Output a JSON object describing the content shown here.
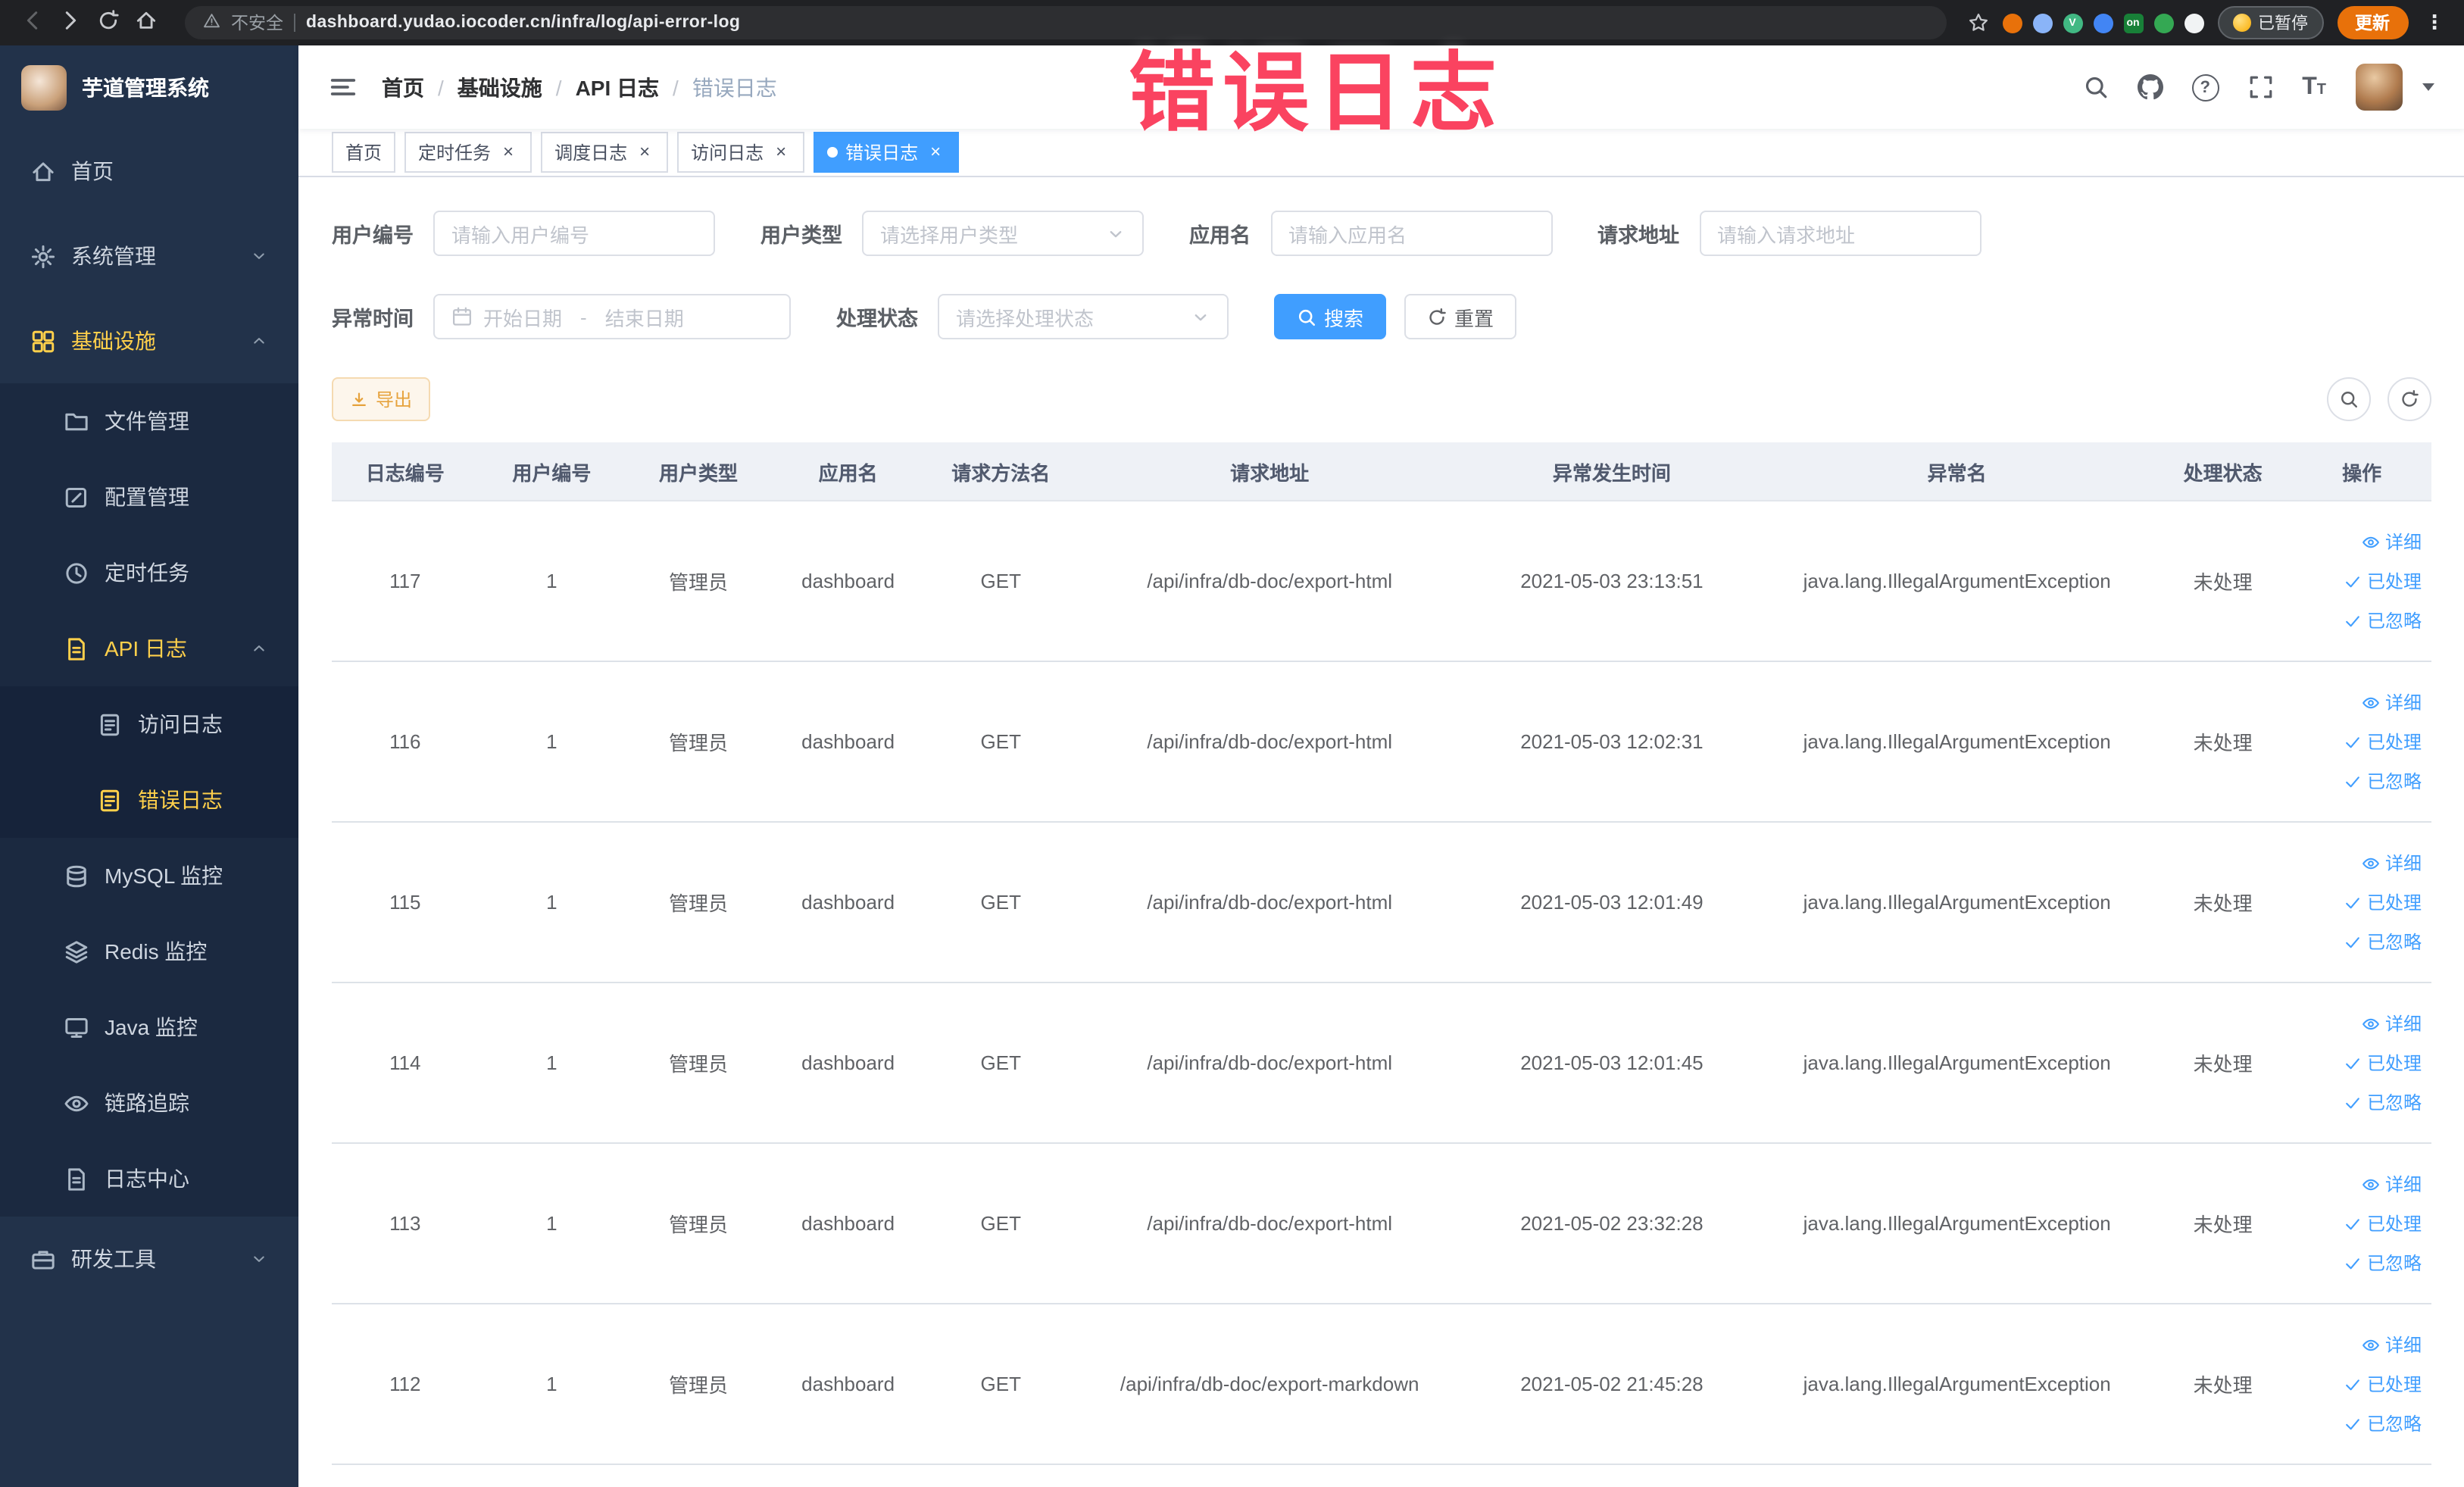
{
  "browser": {
    "security_label": "不安全",
    "url": "dashboard.yudao.iocoder.cn/infra/log/api-error-log",
    "paused_badge": "已暂停",
    "update_button": "更新",
    "extensions": [
      {
        "name": "extension-orange-icon",
        "color": "#e8710a",
        "glyph": ""
      },
      {
        "name": "extension-lightblue-icon",
        "color": "#8ab4f8",
        "glyph": ""
      },
      {
        "name": "extension-vue-devtools-icon",
        "color": "#41b883",
        "glyph": "V"
      },
      {
        "name": "extension-blue-grid-icon",
        "color": "#4285f4",
        "glyph": ""
      },
      {
        "name": "extension-on-badge-icon",
        "color": "#188038",
        "glyph": "on",
        "square": true
      },
      {
        "name": "extension-green-leaf-icon",
        "color": "#34a853",
        "glyph": ""
      },
      {
        "name": "extension-dark-paw-icon",
        "color": "#f1f3f4",
        "glyph": ""
      }
    ]
  },
  "annotation": {
    "text": "错误日志",
    "color": "#fa4360"
  },
  "sidebar": {
    "logo_title": "芋道管理系统",
    "items": [
      {
        "name": "home",
        "label": "首页",
        "icon": "home",
        "level": 1
      },
      {
        "name": "system-management",
        "label": "系统管理",
        "icon": "gear",
        "level": 1,
        "arrow": "down"
      },
      {
        "name": "infrastructure",
        "label": "基础设施",
        "icon": "grid",
        "level": 1,
        "arrow": "up",
        "gold": true
      },
      {
        "name": "file-management",
        "label": "文件管理",
        "icon": "folder",
        "level": 2
      },
      {
        "name": "config-management",
        "label": "配置管理",
        "icon": "edit",
        "level": 2
      },
      {
        "name": "scheduled-jobs",
        "label": "定时任务",
        "icon": "clock",
        "level": 2
      },
      {
        "name": "api-log",
        "label": "API 日志",
        "icon": "doc",
        "level": 2,
        "arrow": "up",
        "gold": true
      },
      {
        "name": "access-log",
        "label": "访问日志",
        "icon": "doc2",
        "level": 3
      },
      {
        "name": "error-log",
        "label": "错误日志",
        "icon": "doc2",
        "level": 3,
        "gold": true
      },
      {
        "name": "mysql-monitor",
        "label": "MySQL 监控",
        "icon": "db",
        "level": 2
      },
      {
        "name": "redis-monitor",
        "label": "Redis 监控",
        "icon": "layers",
        "level": 2
      },
      {
        "name": "java-monitor",
        "label": "Java 监控",
        "icon": "monitor",
        "level": 2
      },
      {
        "name": "trace",
        "label": "链路追踪",
        "icon": "eye",
        "level": 2
      },
      {
        "name": "log-center",
        "label": "日志中心",
        "icon": "doc",
        "level": 2
      },
      {
        "name": "dev-tools",
        "label": "研发工具",
        "icon": "toolbox",
        "level": 1,
        "arrow": "down"
      }
    ]
  },
  "breadcrumb": {
    "items": [
      "首页",
      "基础设施",
      "API 日志",
      "错误日志"
    ]
  },
  "tabs": {
    "items": [
      {
        "name": "home",
        "label": "首页",
        "closable": false,
        "active": false
      },
      {
        "name": "scheduled-jobs",
        "label": "定时任务",
        "closable": true,
        "active": false
      },
      {
        "name": "schedule-log",
        "label": "调度日志",
        "closable": true,
        "active": false
      },
      {
        "name": "access-log",
        "label": "访问日志",
        "closable": true,
        "active": false
      },
      {
        "name": "error-log",
        "label": "错误日志",
        "closable": true,
        "active": true
      }
    ]
  },
  "filters": {
    "user_id": {
      "label": "用户编号",
      "placeholder": "请输入用户编号"
    },
    "user_type": {
      "label": "用户类型",
      "placeholder": "请选择用户类型"
    },
    "app_name": {
      "label": "应用名",
      "placeholder": "请输入应用名"
    },
    "request_url": {
      "label": "请求地址",
      "placeholder": "请输入请求地址"
    },
    "exception_time": {
      "label": "异常时间",
      "start_placeholder": "开始日期",
      "separator": "-",
      "end_placeholder": "结束日期"
    },
    "process_status": {
      "label": "处理状态",
      "placeholder": "请选择处理状态"
    },
    "search_button": "搜索",
    "reset_button": "重置"
  },
  "toolbar": {
    "export_button": "导出"
  },
  "table": {
    "columns": [
      "日志编号",
      "用户编号",
      "用户类型",
      "应用名",
      "请求方法名",
      "请求地址",
      "异常发生时间",
      "异常名",
      "处理状态",
      "操作"
    ],
    "row_actions": [
      "详细",
      "已处理",
      "已忽略"
    ],
    "rows": [
      {
        "id": "117",
        "user_id": "1",
        "user_type": "管理员",
        "app": "dashboard",
        "method": "GET",
        "url": "/api/infra/db-doc/export-html",
        "time": "2021-05-03 23:13:51",
        "exception": "java.lang.IllegalArgumentException",
        "status": "未处理"
      },
      {
        "id": "116",
        "user_id": "1",
        "user_type": "管理员",
        "app": "dashboard",
        "method": "GET",
        "url": "/api/infra/db-doc/export-html",
        "time": "2021-05-03 12:02:31",
        "exception": "java.lang.IllegalArgumentException",
        "status": "未处理"
      },
      {
        "id": "115",
        "user_id": "1",
        "user_type": "管理员",
        "app": "dashboard",
        "method": "GET",
        "url": "/api/infra/db-doc/export-html",
        "time": "2021-05-03 12:01:49",
        "exception": "java.lang.IllegalArgumentException",
        "status": "未处理"
      },
      {
        "id": "114",
        "user_id": "1",
        "user_type": "管理员",
        "app": "dashboard",
        "method": "GET",
        "url": "/api/infra/db-doc/export-html",
        "time": "2021-05-03 12:01:45",
        "exception": "java.lang.IllegalArgumentException",
        "status": "未处理"
      },
      {
        "id": "113",
        "user_id": "1",
        "user_type": "管理员",
        "app": "dashboard",
        "method": "GET",
        "url": "/api/infra/db-doc/export-html",
        "time": "2021-05-02 23:32:28",
        "exception": "java.lang.IllegalArgumentException",
        "status": "未处理"
      },
      {
        "id": "112",
        "user_id": "1",
        "user_type": "管理员",
        "app": "dashboard",
        "method": "GET",
        "url": "/api/infra/db-doc/export-markdown",
        "time": "2021-05-02 21:45:28",
        "exception": "java.lang.IllegalArgumentException",
        "status": "未处理"
      }
    ]
  },
  "colors": {
    "accent": "#409EFF",
    "active_menu_text": "#ffd04b",
    "warning": "#e6a23c",
    "table_header_bg": "#eef1f6"
  }
}
